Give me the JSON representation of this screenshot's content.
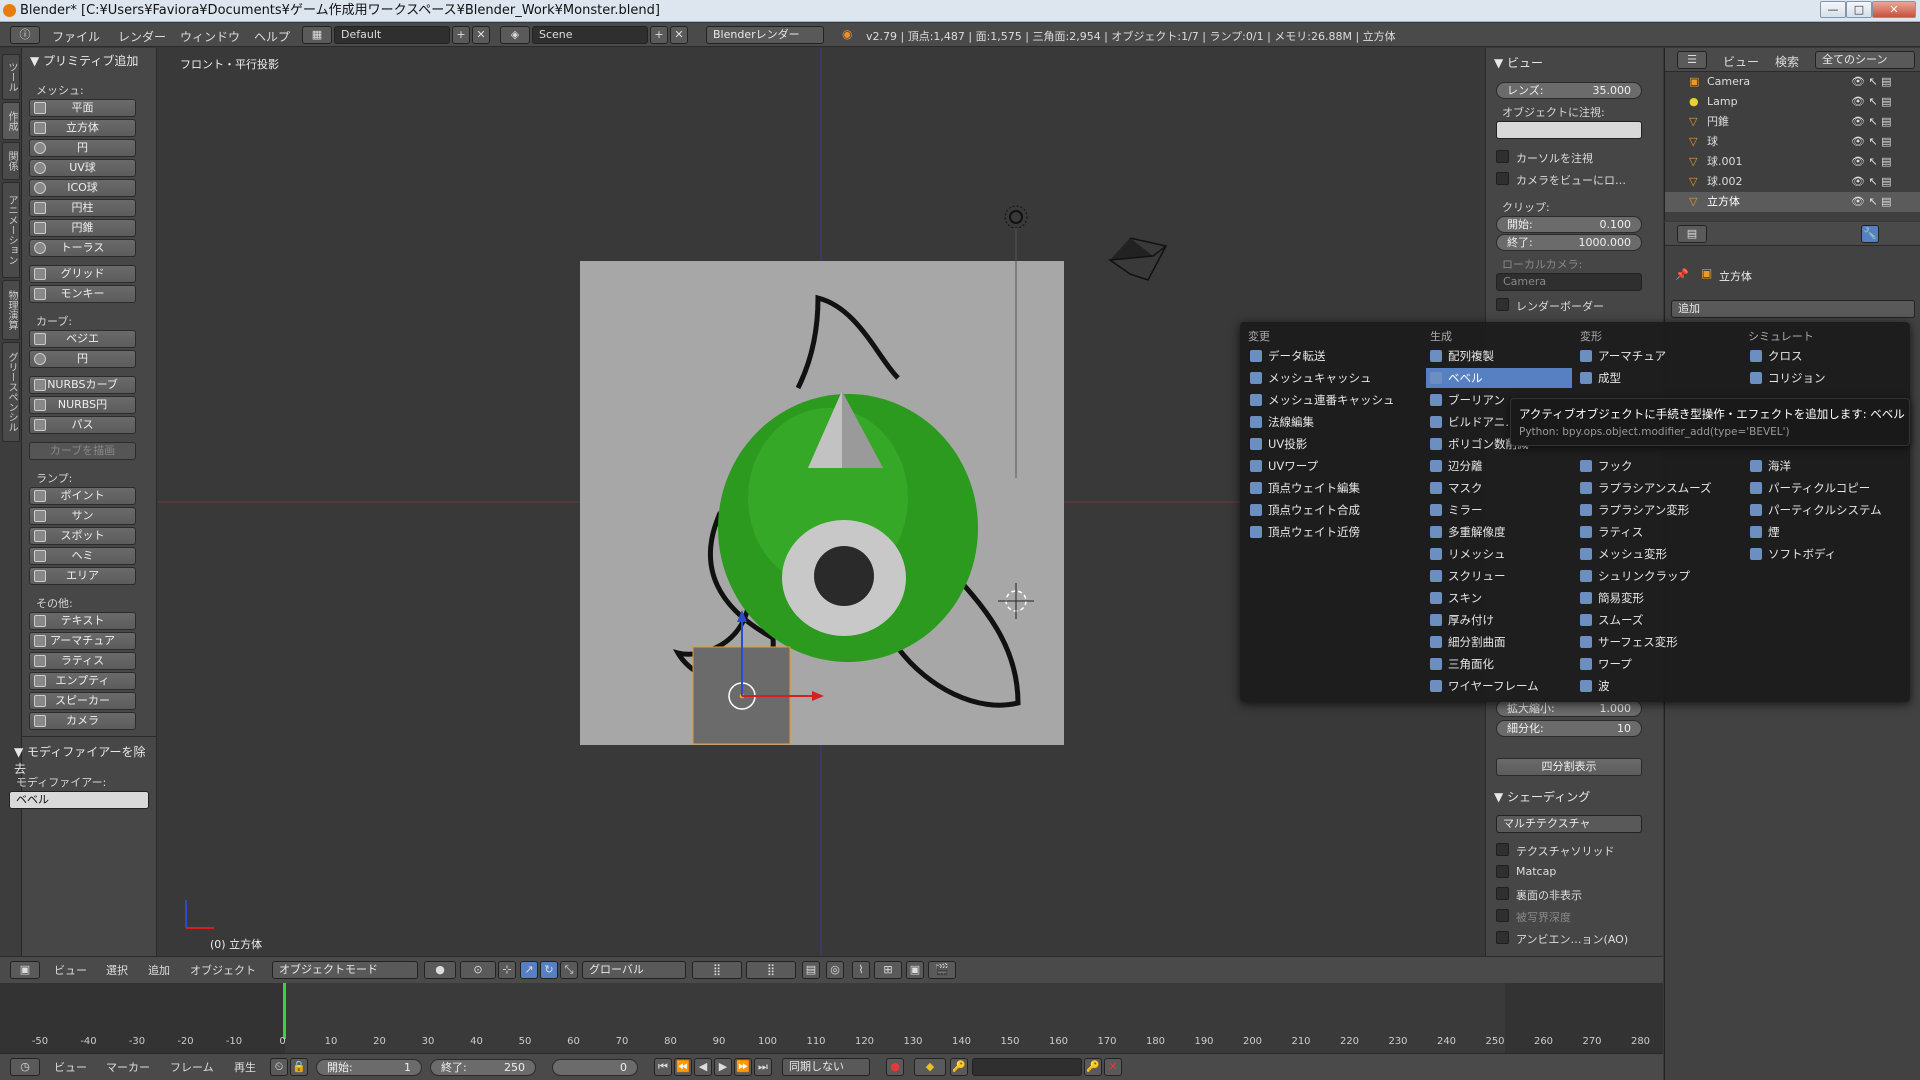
{
  "title": "Blender* [C:¥Users¥Faviora¥Documents¥ゲーム作成用ワークスペース¥Blender_Work¥Monster.blend]",
  "menubar": {
    "items": [
      "ファイル",
      "レンダー",
      "ウィンドウ",
      "ヘルプ"
    ],
    "layout": "Default",
    "scene": "Scene",
    "engine": "Blenderレンダー",
    "stats": "v2.79 | 頂点:1,487 | 面:1,575 | 三角面:2,954 | オブジェクト:1/7 | ランプ:0/1 | メモリ:26.88M | 立方体"
  },
  "lefttabs": [
    "ツール",
    "作成",
    "関係",
    "アニメーション",
    "物理演算",
    "グリースペンシル"
  ],
  "toolshelf": {
    "header": "▼ プリミティブ追加",
    "mesh_label": "メッシュ:",
    "mesh": [
      "平面",
      "立方体",
      "円",
      "UV球",
      "ICO球",
      "円柱",
      "円錐",
      "トーラス"
    ],
    "mesh2": [
      "グリッド",
      "モンキー"
    ],
    "curve_label": "カーブ:",
    "curve": [
      "ベジエ",
      "円"
    ],
    "curve2": [
      "NURBSカーブ",
      "NURBS円",
      "パス"
    ],
    "draw_curve": "カーブを描画",
    "lamp_label": "ランプ:",
    "lamp": [
      "ポイント",
      "サン",
      "スポット",
      "ヘミ",
      "エリア"
    ],
    "other_label": "その他:",
    "other": [
      "テキスト",
      "アーマチュア",
      "ラティス",
      "エンプティ",
      "スピーカー",
      "カメラ"
    ],
    "op_header": "▼ モディファイアーを除去",
    "op_label": "モディファイアー:",
    "op_value": "ベベル"
  },
  "viewport": {
    "view_label": "フロント・平行投影",
    "object_label": "(0) 立方体"
  },
  "rpanel": {
    "view_header": "▼ ビュー",
    "lens_label": "レンズ:",
    "lens_value": "35.000",
    "lock_label": "オブジェクトに注視:",
    "lock_cursor": "カーソルを注視",
    "lock_camera": "カメラをビューにロ…",
    "clip_label": "クリップ:",
    "clip_start_label": "開始:",
    "clip_start": "0.100",
    "clip_end_label": "終了:",
    "clip_end": "1000.000",
    "local_cam_label": "ローカルカメラ:",
    "local_cam": "Camera",
    "render_border": "レンダーボーダー",
    "scale_label": "拡大縮小:",
    "scale_value": "1.000",
    "subdiv_label": "細分化:",
    "subdiv_value": "10",
    "quad_view": "四分割表示",
    "shading_header": "▼ シェーディング",
    "shading_mode": "マルチテクスチャ",
    "shading_opts": [
      "テクスチャソリッド",
      "Matcap",
      "裏面の非表示",
      "被写界深度",
      "アンビエン…ョン(AO)"
    ]
  },
  "outliner": {
    "tabs": [
      "ビュー",
      "検索",
      "全てのシーン"
    ],
    "items": [
      "Camera",
      "Lamp",
      "円錐",
      "球",
      "球.001",
      "球.002",
      "立方体"
    ]
  },
  "props": {
    "object": "立方体",
    "add_button": "追加"
  },
  "menu": {
    "columns": [
      {
        "header": "変更",
        "items": [
          "データ転送",
          "メッシュキャッシュ",
          "メッシュ連番キャッシュ",
          "法線編集",
          "UV投影",
          "UVワープ",
          "頂点ウェイト編集",
          "頂点ウェイト合成",
          "頂点ウェイト近傍"
        ]
      },
      {
        "header": "生成",
        "items": [
          "配列複製",
          "ベベル",
          "ブーリアン",
          "ビルドアニ…",
          "ポリゴン数削減",
          "辺分離",
          "マスク",
          "ミラー",
          "多重解像度",
          "リメッシュ",
          "スクリュー",
          "スキン",
          "厚み付け",
          "細分割曲面",
          "三角面化",
          "ワイヤーフレーム"
        ]
      },
      {
        "header": "変形",
        "items": [
          "アーマチュア",
          "成型",
          "",
          "",
          "",
          "フック",
          "ラプラシアンスムーズ",
          "ラプラシアン変形",
          "ラティス",
          "メッシュ変形",
          "シュリンクラップ",
          "簡易変形",
          "スムーズ",
          "サーフェス変形",
          "ワープ",
          "波"
        ]
      },
      {
        "header": "シミュレート",
        "items": [
          "クロス",
          "コリジョン",
          "",
          "",
          "",
          "海洋",
          "パーティクルコピー",
          "パーティクルシステム",
          "煙",
          "ソフトボディ"
        ]
      }
    ],
    "highlight": "ベベル"
  },
  "tooltip": {
    "line1": "アクティブオブジェクトに手続き型操作・エフェクトを追加します: ベベル",
    "line2": "Python: bpy.ops.object.modifier_add(type='BEVEL')"
  },
  "vheader": {
    "items": [
      "ビュー",
      "選択",
      "追加",
      "オブジェクト"
    ],
    "mode": "オブジェクトモード",
    "orientation": "グローバル"
  },
  "timeline": {
    "ticks": [
      "-50",
      "-40",
      "-30",
      "-20",
      "-10",
      "0",
      "10",
      "20",
      "30",
      "40",
      "50",
      "60",
      "70",
      "80",
      "90",
      "100",
      "110",
      "120",
      "130",
      "140",
      "150",
      "160",
      "170",
      "180",
      "190",
      "200",
      "210",
      "220",
      "230",
      "240",
      "250",
      "260",
      "270",
      "280"
    ],
    "current_frame": 0
  },
  "tlfooter": {
    "items": [
      "ビュー",
      "マーカー",
      "フレーム",
      "再生"
    ],
    "start_label": "開始:",
    "start": "1",
    "end_label": "終了:",
    "end": "250",
    "frame": "0",
    "sync": "同期しない"
  }
}
